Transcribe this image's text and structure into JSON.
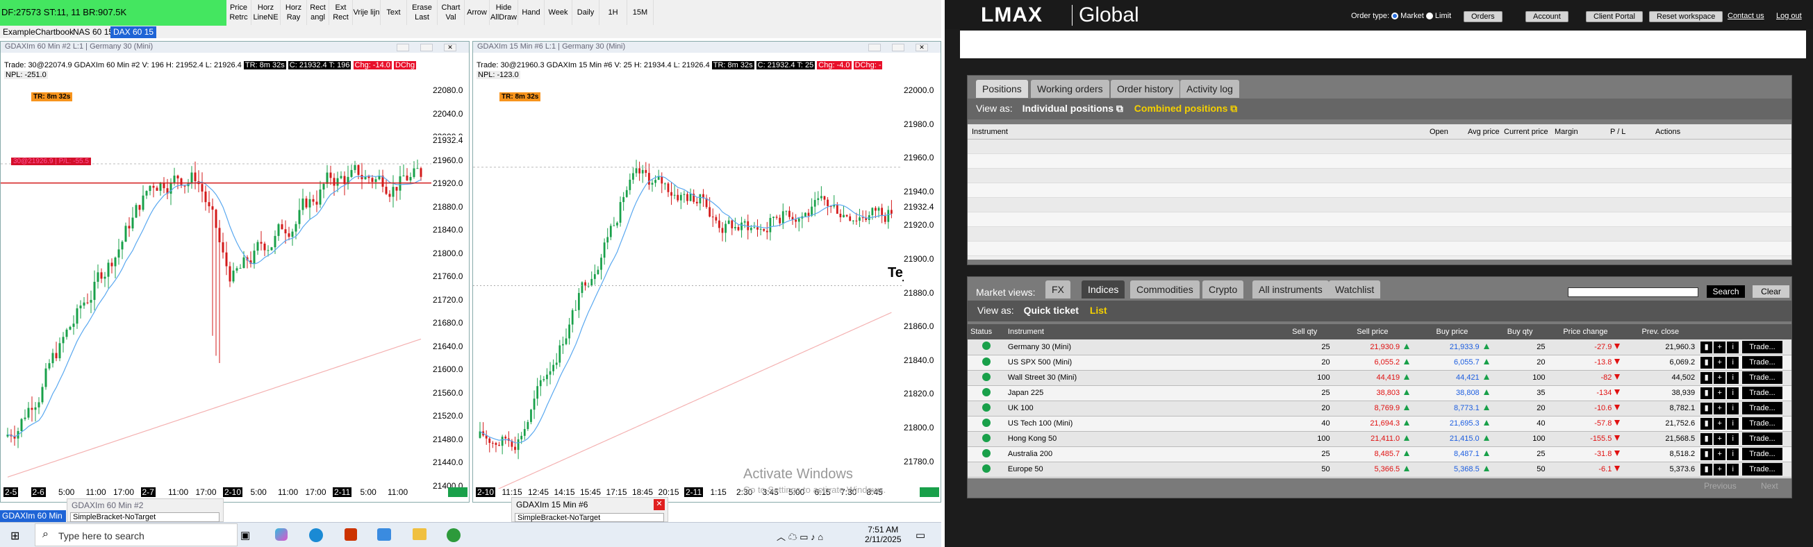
{
  "toolbar": {
    "account": "DF:27573 ST:11, 11 BR:907.5K",
    "buttons": [
      "Price\nRetrc",
      "Horz\nLineNE",
      "Horz\nRay",
      "Rect\nangl",
      "Ext\nRect",
      "Vrije lijn",
      "Text",
      "Erase\nLast",
      "Chart\nVal",
      "Arrow",
      "Hide\nAllDraw",
      "Hand",
      "Week",
      "Daily",
      "1H",
      "15M"
    ]
  },
  "chart_tabs": [
    "ExampleChartbook",
    "NAS 60 15",
    "DAX 60 15"
  ],
  "chart1": {
    "title": "GDAXIm  60 Min  #2 L:1 | Germany 30 (Mini)",
    "trade": "Trade: 30@22074.9",
    "info": "GDAXIm  60 Min  #2 V: 196 H: 21952.4 L: 21926.4",
    "tr": "TR: 8m 32s",
    "close": "C: 21932.4 T: 196",
    "chg": "Chg: -14.0",
    "dchg": "DChg",
    "npl": "NPL: -251.0",
    "tr_badge": "TR: 8m 32s",
    "pos_label": "30@21926.9 | P/L: -55.5",
    "price_tag": "21932.4",
    "y_ticks": [
      "22080.0",
      "22040.0",
      "22000.0",
      "21960.0",
      "21920.0",
      "21880.0",
      "21840.0",
      "21800.0",
      "21760.0",
      "21720.0",
      "21680.0",
      "21640.0",
      "21600.0",
      "21560.0",
      "21520.0",
      "21480.0",
      "21440.0",
      "21400.0"
    ],
    "x_ticks": [
      [
        "2-5",
        "blk"
      ],
      [
        "2-6",
        "blk"
      ],
      [
        "5:00",
        ""
      ],
      [
        "11:00",
        ""
      ],
      [
        "17:00",
        ""
      ],
      [
        "2-7",
        "blk"
      ],
      [
        "11:00",
        ""
      ],
      [
        "17:00",
        ""
      ],
      [
        "2-10",
        "blk"
      ],
      [
        "5:00",
        ""
      ],
      [
        "11:00",
        ""
      ],
      [
        "17:00",
        ""
      ],
      [
        "2-11",
        "blk"
      ],
      [
        "5:00",
        ""
      ],
      [
        "11:00",
        ""
      ]
    ]
  },
  "chart2": {
    "title": "GDAXIm  15 Min  #6 L:1 | Germany 30 (Mini)",
    "trade": "Trade: 30@21960.3",
    "info": "GDAXIm  15 Min  #6 V: 25 H: 21934.4 L: 21926.4",
    "tr": "TR: 8m 32s",
    "close": "C: 21932.4 T: 25",
    "chg": "Chg: -4.0",
    "dchg": "DChg: -",
    "npl": "NPL: -123.0",
    "tr_badge": "TR: 8m 32s",
    "price_tag": "21932.4",
    "tekst": "Tekst",
    "y_ticks": [
      "22000.0",
      "21980.0",
      "21960.0",
      "21940.0",
      "21920.0",
      "21900.0",
      "21880.0",
      "21860.0",
      "21840.0",
      "21820.0",
      "21800.0",
      "21780.0"
    ],
    "x_ticks": [
      [
        "2-10",
        "blk"
      ],
      [
        "11:15",
        ""
      ],
      [
        "12:45",
        ""
      ],
      [
        "14:15",
        ""
      ],
      [
        "15:45",
        ""
      ],
      [
        "17:15",
        ""
      ],
      [
        "18:45",
        ""
      ],
      [
        "20:15",
        ""
      ],
      [
        "2-11",
        "blk"
      ],
      [
        "1:15",
        ""
      ],
      [
        "2:30",
        ""
      ],
      [
        "3:45",
        ""
      ],
      [
        "5:00",
        ""
      ],
      [
        "6:15",
        ""
      ],
      [
        "7:30",
        ""
      ],
      [
        "8:45",
        ""
      ]
    ]
  },
  "bottom_panels": {
    "left_status": "GDAXIm  60 Min",
    "panel1_title": "GDAXIm  60 Min  #2",
    "panel1_select": "SimpleBracket-NoTarget",
    "panel2_title": "GDAXIm  15 Min  #6",
    "panel2_select": "SimpleBracket-NoTarget",
    "watermark1": "Activate Windows",
    "watermark2": "Go to Settings to activate Windows."
  },
  "taskbar": {
    "search_placeholder": "Type here to search",
    "time": "7:51 AM",
    "date": "2/11/2025"
  },
  "lmax": {
    "logo_main": "LMAX",
    "logo_sub": "Global",
    "order_type_label": "Order type:",
    "order_market": "Market",
    "order_limit": "Limit",
    "buttons": [
      "Orders",
      "Account",
      "Client Portal",
      "Reset workspace"
    ],
    "links": [
      "Contact us",
      "Log out"
    ],
    "positions_tabs": [
      "Positions",
      "Working orders",
      "Order history",
      "Activity log"
    ],
    "view_as": "View as:",
    "individual": "Individual positions",
    "combined": "Combined positions",
    "pos_headers": [
      "Instrument",
      "Open",
      "Avg price",
      "Current price",
      "Margin",
      "P / L",
      "Actions"
    ],
    "market_views_label": "Market views:",
    "market_tabs": [
      "FX",
      "Indices",
      "Commodities",
      "Crypto",
      "All instruments",
      "Watchlist"
    ],
    "search_btn": "Search",
    "clear_btn": "Clear",
    "quick_ticket": "Quick ticket",
    "list": "List",
    "market_headers": [
      "Status",
      "Instrument",
      "Sell qty",
      "Sell price",
      "Buy price",
      "Buy qty",
      "Price change",
      "Prev. close"
    ],
    "rows": [
      [
        "Germany 30 (Mini)",
        "25",
        "21,930.9",
        "21,933.9",
        "25",
        "-27.9",
        "21,960.3"
      ],
      [
        "US SPX 500 (Mini)",
        "20",
        "6,055.2",
        "6,055.7",
        "20",
        "-13.8",
        "6,069.2"
      ],
      [
        "Wall Street 30 (Mini)",
        "100",
        "44,419",
        "44,421",
        "100",
        "-82",
        "44,502"
      ],
      [
        "Japan 225",
        "25",
        "38,803",
        "38,808",
        "35",
        "-134",
        "38,939"
      ],
      [
        "UK 100",
        "20",
        "8,769.9",
        "8,773.1",
        "20",
        "-10.6",
        "8,782.1"
      ],
      [
        "US Tech 100 (Mini)",
        "40",
        "21,694.3",
        "21,695.3",
        "40",
        "-57.8",
        "21,752.6"
      ],
      [
        "Hong Kong 50",
        "100",
        "21,411.0",
        "21,415.0",
        "100",
        "-155.5",
        "21,568.5"
      ],
      [
        "Australia 200",
        "25",
        "8,485.7",
        "8,487.1",
        "25",
        "-31.8",
        "8,518.2"
      ],
      [
        "Europe 50",
        "50",
        "5,366.5",
        "5,368.5",
        "50",
        "-6.1",
        "5,373.6"
      ]
    ],
    "trade_label": "Trade...",
    "previous": "Previous",
    "next": "Next"
  }
}
